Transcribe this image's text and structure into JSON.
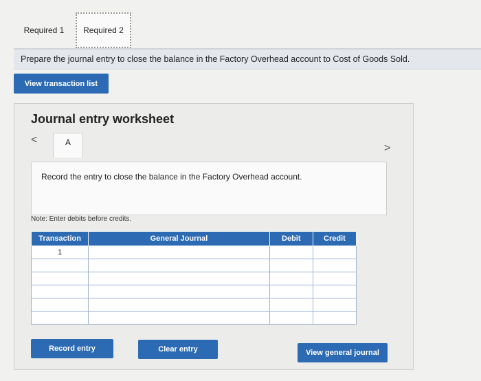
{
  "tabs": [
    {
      "label": "Required 1"
    },
    {
      "label": "Required 2"
    }
  ],
  "prompt": "Prepare the journal entry to close the balance in the Factory Overhead account to Cost of Goods Sold.",
  "view_transaction_list": "View transaction list",
  "worksheet": {
    "title": "Journal entry worksheet",
    "nav_prev": "<",
    "nav_next": ">",
    "entry_tab": "A",
    "entry_instruction": "Record the entry to close the balance in the Factory Overhead account.",
    "note": "Note: Enter debits before credits.",
    "table": {
      "headers": [
        "Transaction",
        "General Journal",
        "Debit",
        "Credit"
      ],
      "rows": [
        {
          "transaction": "1",
          "general_journal": "",
          "debit": "",
          "credit": ""
        },
        {
          "transaction": "",
          "general_journal": "",
          "debit": "",
          "credit": ""
        },
        {
          "transaction": "",
          "general_journal": "",
          "debit": "",
          "credit": ""
        },
        {
          "transaction": "",
          "general_journal": "",
          "debit": "",
          "credit": ""
        },
        {
          "transaction": "",
          "general_journal": "",
          "debit": "",
          "credit": ""
        },
        {
          "transaction": "",
          "general_journal": "",
          "debit": "",
          "credit": ""
        }
      ]
    },
    "buttons": {
      "record_entry": "Record entry",
      "clear_entry": "Clear entry",
      "view_general_journal": "View general journal"
    }
  },
  "colors": {
    "accent": "#2c6ab4",
    "background": "#f1f2f0"
  }
}
